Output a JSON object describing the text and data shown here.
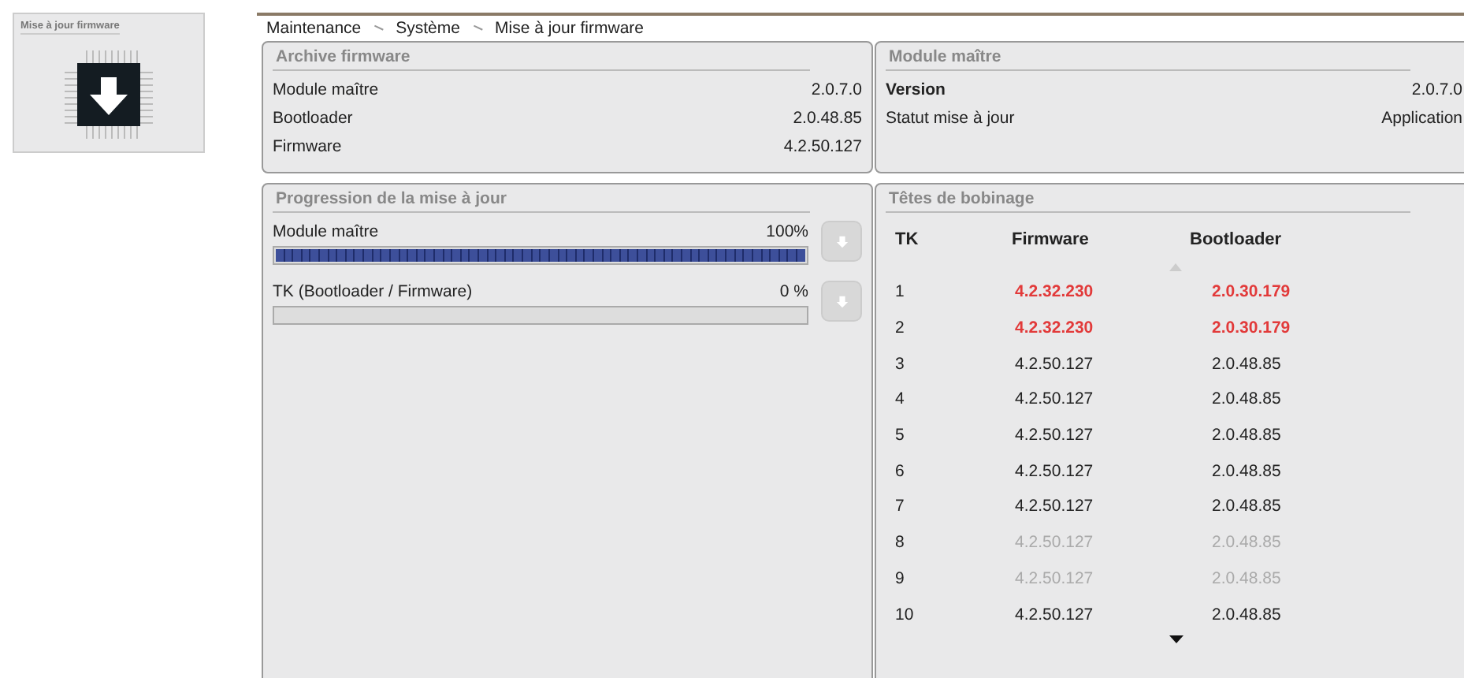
{
  "tile": {
    "title": "Mise à jour firmware"
  },
  "breadcrumb": [
    "Maintenance",
    "Système",
    "Mise à jour firmware"
  ],
  "archive": {
    "title": "Archive firmware",
    "rows": [
      {
        "label": "Module maître",
        "value": "2.0.7.0"
      },
      {
        "label": "Bootloader",
        "value": "2.0.48.85"
      },
      {
        "label": "Firmware",
        "value": "4.2.50.127"
      }
    ]
  },
  "module": {
    "title": "Module maître",
    "rows": [
      {
        "label": "Version",
        "value": "2.0.7.0",
        "bold": true
      },
      {
        "label": "Statut mise à jour",
        "value": "Application",
        "bold": false
      }
    ]
  },
  "progress": {
    "title": "Progression de la mise à jour",
    "items": [
      {
        "label": "Module maître",
        "reading": "100%",
        "level": 1,
        "disabled": true
      },
      {
        "label": "TK (Bootloader / Firmware)",
        "reading": "0 %",
        "level": 0,
        "disabled": true
      }
    ]
  },
  "heads": {
    "title": "Têtes de bobinage",
    "columns": [
      "TK",
      "Firmware",
      "Bootloader"
    ],
    "rows": [
      {
        "tk": "1",
        "firmware": "4.2.32.230",
        "bootloader": "2.0.30.179",
        "kind": "outdated"
      },
      {
        "tk": "2",
        "firmware": "4.2.32.230",
        "bootloader": "2.0.30.179",
        "kind": "outdated"
      },
      {
        "tk": "3",
        "firmware": "4.2.50.127",
        "bootloader": "2.0.48.85",
        "kind": "normal"
      },
      {
        "tk": "4",
        "firmware": "4.2.50.127",
        "bootloader": "2.0.48.85",
        "kind": "normal"
      },
      {
        "tk": "5",
        "firmware": "4.2.50.127",
        "bootloader": "2.0.48.85",
        "kind": "normal"
      },
      {
        "tk": "6",
        "firmware": "4.2.50.127",
        "bootloader": "2.0.48.85",
        "kind": "normal"
      },
      {
        "tk": "7",
        "firmware": "4.2.50.127",
        "bootloader": "2.0.48.85",
        "kind": "normal"
      },
      {
        "tk": "8",
        "firmware": "4.2.50.127",
        "bootloader": "2.0.48.85",
        "kind": "inactive"
      },
      {
        "tk": "9",
        "firmware": "4.2.50.127",
        "bootloader": "2.0.48.85",
        "kind": "inactive"
      },
      {
        "tk": "10",
        "firmware": "4.2.50.127",
        "bootloader": "2.0.48.85",
        "kind": "normal"
      }
    ]
  }
}
